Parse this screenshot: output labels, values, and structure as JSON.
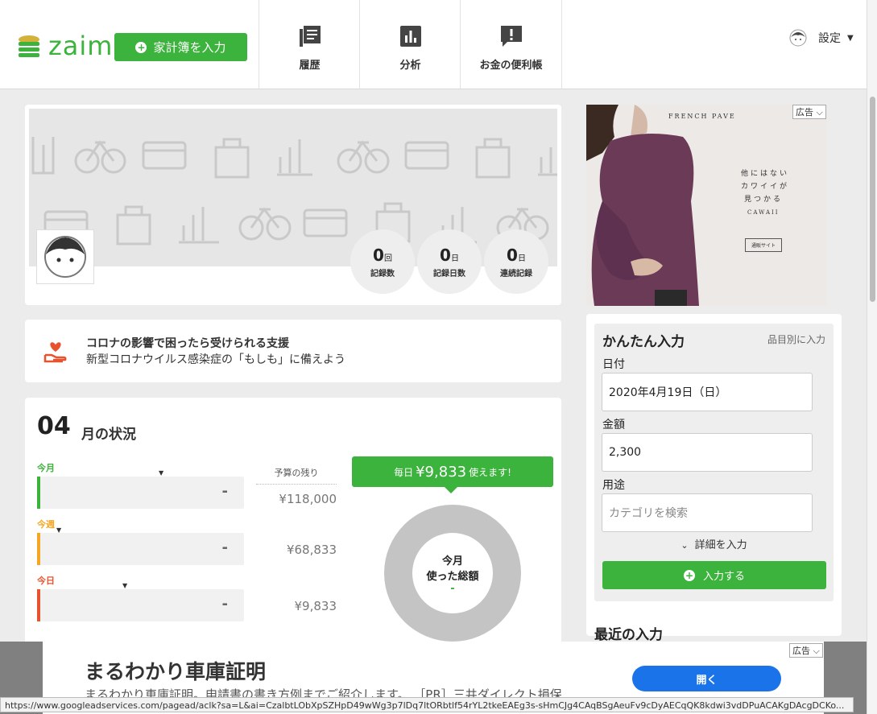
{
  "header": {
    "logo_text": "zaim",
    "input_button": "家計簿を入力",
    "nav": [
      {
        "label": "履歴",
        "icon": "history-icon"
      },
      {
        "label": "分析",
        "icon": "chart-icon"
      },
      {
        "label": "お金の便利帳",
        "icon": "info-icon"
      }
    ],
    "settings": "設定"
  },
  "profile": {
    "stats": [
      {
        "value": "0",
        "unit": "回",
        "label": "記録数"
      },
      {
        "value": "0",
        "unit": "日",
        "label": "記録日数"
      },
      {
        "value": "0",
        "unit": "日",
        "label": "連続記録"
      }
    ]
  },
  "corona": {
    "title": "コロナの影響で困ったら受けられる支援",
    "subtitle": "新型コロナウイルス感染症の「もしも」に備えよう"
  },
  "status": {
    "month_number": "04",
    "month_label": "月の状況",
    "remaining_header": "予算の残り",
    "periods": [
      {
        "label": "今月",
        "value": "-",
        "remaining": "¥118,000",
        "color": "#3cb33c"
      },
      {
        "label": "今週",
        "value": "-",
        "remaining": "¥68,833",
        "color": "#f5a623"
      },
      {
        "label": "今日",
        "value": "-",
        "remaining": "¥9,833",
        "color": "#e8532f"
      }
    ],
    "daily_prefix": "毎日",
    "daily_amount": "¥9,833",
    "daily_suffix": "使えます!",
    "donut_line1": "今月",
    "donut_line2": "使った総額",
    "donut_value": "-"
  },
  "ad_top": {
    "badge": "広告",
    "brand": "FRENCH PAVE",
    "tagline_1": "他にはない",
    "tagline_2": "カワイイが",
    "tagline_3": "見つかる",
    "tagline_4": "CAWAII",
    "button": "通販サイト"
  },
  "quick_input": {
    "title": "かんたん入力",
    "link": "品目別に入力",
    "date_label": "日付",
    "date_value": "2020年4月19日（日）",
    "amount_label": "金額",
    "amount_value": "2,300",
    "category_label": "用途",
    "category_placeholder": "カテゴリを検索",
    "detail": "詳細を入力",
    "submit": "入力する"
  },
  "recent_title": "最近の入力",
  "bottom_ad": {
    "badge": "広告",
    "title": "まるわかり車庫証明",
    "subtitle": "まるわかり車庫証明。申請書の書き方例までご紹介します。 ［PR］三井ダイレクト損保",
    "open_button": "開く"
  },
  "status_url": "https://www.googleadservices.com/pagead/aclk?sa=L&ai=CzalbtLObXpSZHpD49wWg3p7lDq7ltORbtlf54rYL2tkeEAEg3s-sHmCJg4CAqBSgAeuFv9cDyAECqQK8kdwi3vdDPuACAKgDAcgDCKo..."
}
